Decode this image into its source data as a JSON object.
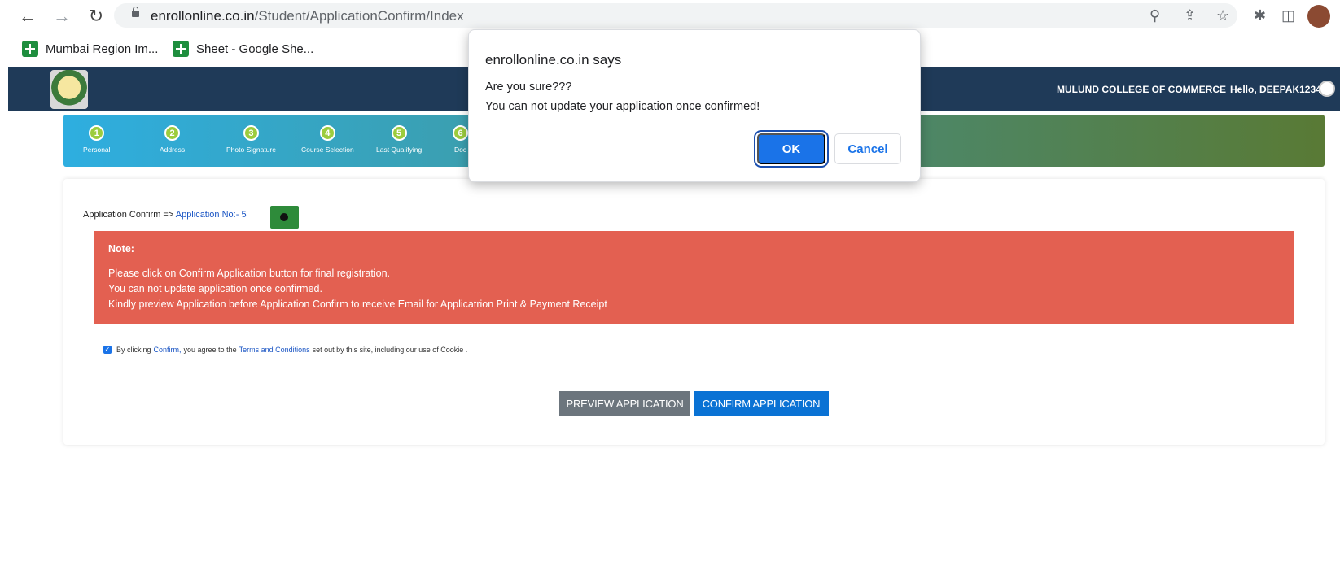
{
  "browser": {
    "url_host": "enrollonline.co.in",
    "url_path": "/Student/ApplicationConfirm/Index",
    "bookmarks": [
      "Mumbai Region Im...",
      "Sheet - Google She..."
    ]
  },
  "header": {
    "college_name": "MULUND COLLEGE OF COMMERCE",
    "greeting": "Hello, DEEPAK1234"
  },
  "steps": [
    {
      "num": "1",
      "label": "Personal"
    },
    {
      "num": "2",
      "label": "Address"
    },
    {
      "num": "3",
      "label": "Photo Signature"
    },
    {
      "num": "4",
      "label": "Course Selection"
    },
    {
      "num": "5",
      "label": "Last Qualifying"
    },
    {
      "num": "6",
      "label": "Doc"
    }
  ],
  "main": {
    "breadcrumb_prefix": "Application Confirm =>",
    "application_no": "Application No:- 5",
    "note": {
      "title": "Note:",
      "lines": [
        "Please click on Confirm Application button for final registration.",
        "You can not update application once confirmed.",
        "Kindly preview Application before Application Confirm to receive Email for Applicatrion Print & Payment Receipt"
      ]
    },
    "agree": {
      "part1": "By clicking",
      "confirm_link": "Confirm,",
      "part2": "you agree to the",
      "terms_link": "Terms and Conditions",
      "part3": "set out by this site, including our use of Cookie ."
    },
    "preview_button": "PREVIEW APPLICATION",
    "confirm_button": "CONFIRM APPLICATION"
  },
  "dialog": {
    "title": "enrollonline.co.in says",
    "line1": "Are you sure???",
    "line2": "You can not update your application once confirmed!",
    "ok": "OK",
    "cancel": "Cancel"
  },
  "colors": {
    "header_bg": "#1f3a58",
    "note_bg": "#e36051",
    "confirm_btn": "#0a72d4",
    "preview_btn": "#6c757d"
  }
}
